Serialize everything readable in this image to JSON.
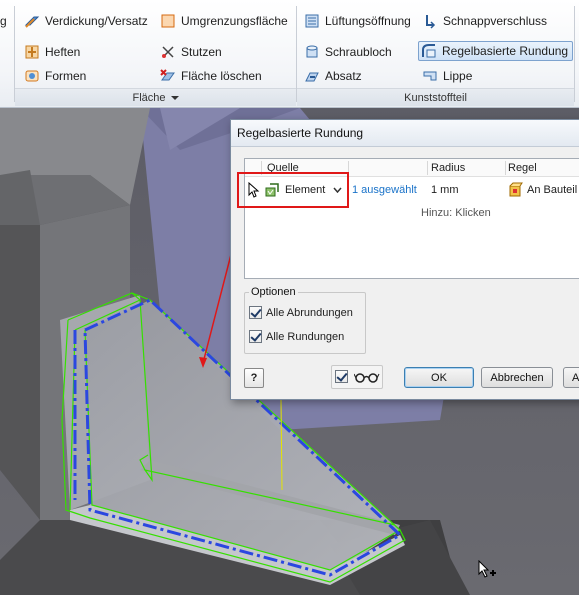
{
  "ribbon": {
    "left_partial": "g",
    "col1": [
      "Verdickung/Versatz",
      "Heften",
      "Formen"
    ],
    "col2": [
      "Umgrenzungsfläche",
      "Stutzen",
      "Fläche löschen"
    ],
    "col3": [
      "Lüftungsöffnung",
      "Schraubloch",
      "Absatz"
    ],
    "col4": [
      "Schnappverschluss",
      "Regelbasierte Rundung",
      "Lippe"
    ],
    "panel_flaeche": "Fläche",
    "panel_kunststoff": "Kunststoffteil"
  },
  "dialog": {
    "title": "Regelbasierte Rundung",
    "columns": {
      "quelle": "Quelle",
      "radius": "Radius",
      "regel": "Regel"
    },
    "row": {
      "quelle_value": "Element",
      "selection": "1 ausgewählt",
      "radius": "1 mm",
      "regel": "An Bauteil"
    },
    "add_hint": "Hinzu: Klicken",
    "options_group": "Optionen",
    "opt_alle_abrundungen": "Alle Abrundungen",
    "opt_alle_rundungen": "Alle Rundungen",
    "help_label": "?",
    "ok": "OK",
    "cancel": "Abbrechen",
    "apply_partial": "An"
  },
  "colors": {
    "accent_selected": "#cfe2f7",
    "highlight_red": "#e01818",
    "selection_blue": "#2b47e0",
    "edge_green": "#35e000",
    "link_blue": "#1a73c9"
  },
  "icons": {
    "verdickung": "thicken-icon",
    "heften": "rib-icon",
    "formen": "shape-icon",
    "umgrenzung": "boundary-patch-icon",
    "stutzen": "trim-icon",
    "flaeche_loeschen": "delete-face-icon",
    "lueftung": "grill-icon",
    "schraubloch": "boss-icon",
    "absatz": "rest-icon",
    "schnapp": "snap-fit-icon",
    "regel_rundung": "rule-fillet-icon",
    "lippe": "lip-icon"
  }
}
